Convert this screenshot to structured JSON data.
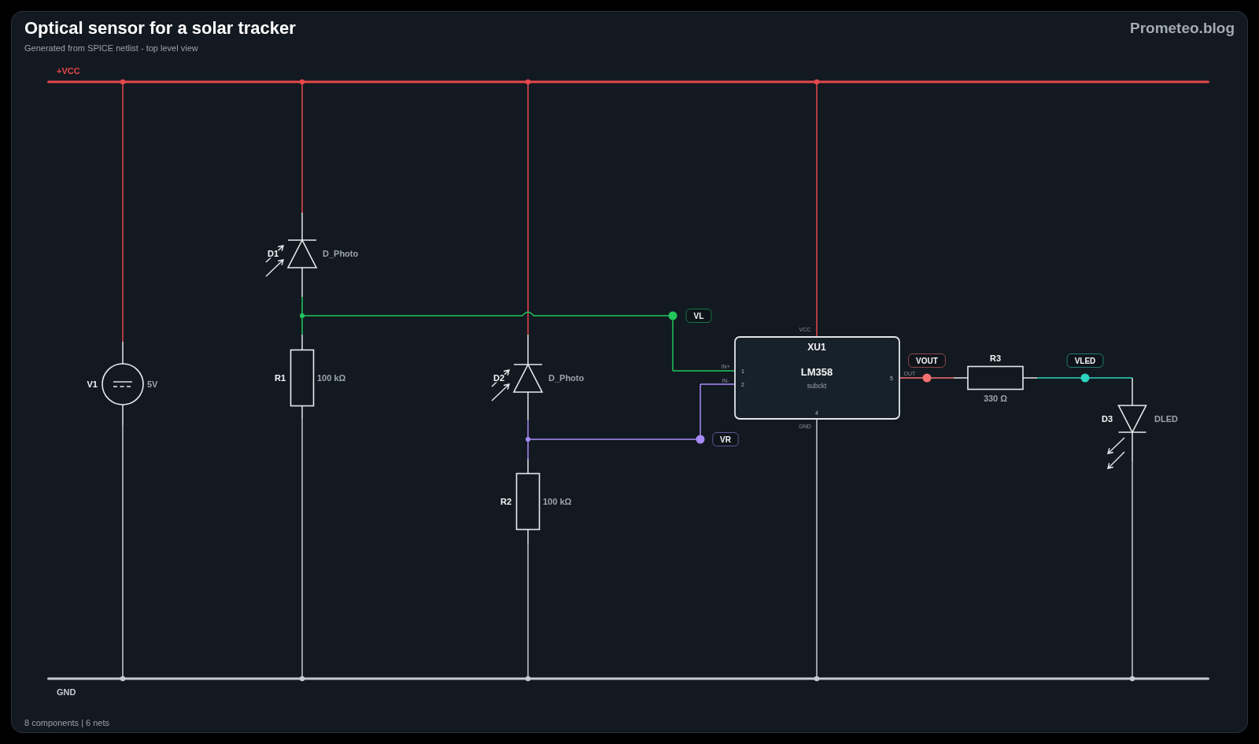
{
  "header": {
    "title": "Optical sensor for a solar tracker",
    "subtitle": "Generated from SPICE netlist - top level view",
    "brand": "Prometeo.blog"
  },
  "rails": [
    {
      "kind": "vcc",
      "label": "+VCC",
      "color": "#e5484d"
    },
    {
      "kind": "gnd",
      "label": "GND",
      "color": "#c5cad3"
    }
  ],
  "components": [
    {
      "kind": "source",
      "ref": "V1",
      "value": "5V"
    },
    {
      "kind": "photodiode",
      "ref": "D1",
      "value": "D_Photo"
    },
    {
      "kind": "resistor",
      "ref": "R1",
      "value": "100 kΩ"
    },
    {
      "kind": "photodiode",
      "ref": "D2",
      "value": "D_Photo"
    },
    {
      "kind": "resistor",
      "ref": "R2",
      "value": "100 kΩ"
    },
    {
      "kind": "opamp",
      "ref": "XU1",
      "value": "LM358",
      "model": "subckt",
      "pins": [
        {
          "name": "VCC"
        },
        {
          "name": "IN+",
          "number": "1"
        },
        {
          "name": "IN-",
          "number": "2"
        },
        {
          "name": "OUT",
          "number": "5"
        },
        {
          "name": "GND",
          "number": "4"
        }
      ]
    },
    {
      "kind": "resistor",
      "ref": "R3",
      "value": "330 Ω"
    },
    {
      "kind": "led",
      "ref": "D3",
      "value": "DLED"
    }
  ],
  "nets": [
    {
      "label": "VL",
      "color": "#22c55e"
    },
    {
      "label": "VOUT",
      "color": "#f87171"
    },
    {
      "label": "VLED",
      "color": "#2dd4bf"
    },
    {
      "label": "VR",
      "color": "#a78bfa"
    }
  ],
  "footer": "8 components | 6 nets"
}
